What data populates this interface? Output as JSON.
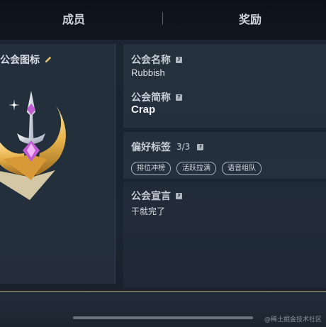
{
  "emblem": {
    "title": "公会图标",
    "edit_icon": "pencil-icon",
    "colors": {
      "gold": "#e7b24a",
      "gem": "#c15bd1",
      "silver": "#cfd6e2"
    }
  },
  "guild": {
    "name_label": "公会名称",
    "name_value": "Rubbish",
    "abbr_label": "公会简称",
    "abbr_value": "Crap",
    "tags_label": "偏好标签",
    "tags_count": "3/3",
    "tags": [
      "排位冲榜",
      "活跃拉满",
      "语音组队"
    ],
    "declaration_label": "公会宣言",
    "declaration_value": "干就完了",
    "help_icon": "question-mark-icon",
    "help_glyph": "?"
  },
  "bottom_tabs": {
    "members": "成员",
    "rewards": "奖励",
    "accent": "#b9a678"
  },
  "watermark": "@稀土掘金技术社区"
}
